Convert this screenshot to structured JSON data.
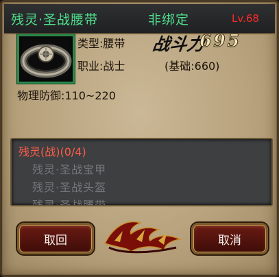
{
  "header": {
    "item_name": "残灵·圣战腰带",
    "bind_status": "非绑定",
    "level": "Lv.68"
  },
  "item": {
    "icon": "belt-icon",
    "type_text": "类型:腰带",
    "job_text": "职业:战士",
    "power_label": "战斗力",
    "power_value": "695",
    "base_text": "(基础:660)"
  },
  "stats": {
    "defense_text": "物理防御:110~220"
  },
  "set_bonus": {
    "header": "残灵(战)(0/4)",
    "items": [
      "残灵·圣战宝甲",
      "残灵·圣战头盔",
      "残灵·圣战腰带"
    ]
  },
  "buttons": {
    "retrieve": "取回",
    "cancel": "取消"
  },
  "colors": {
    "title_green": "#4fe08d",
    "level_red": "#ff2a2a",
    "set_header_red": "#ff5d4a",
    "set_item_gray": "#74777a"
  }
}
